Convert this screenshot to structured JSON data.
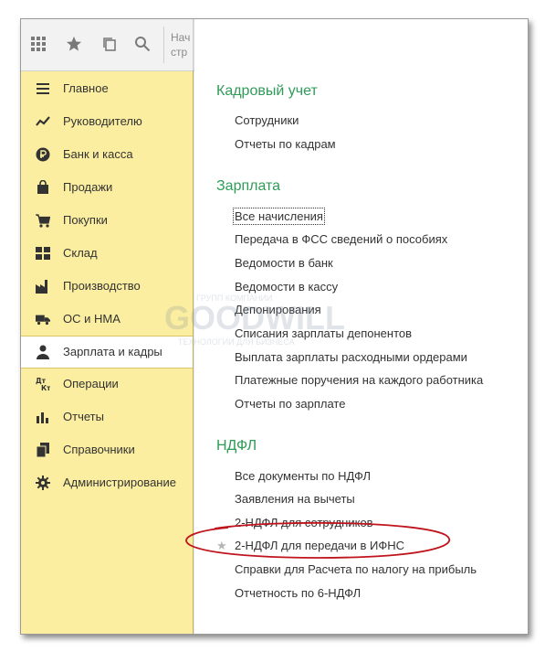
{
  "toolbar": {
    "hint_lines": [
      "Нач",
      "стр"
    ],
    "icons": [
      "apps-grid-icon",
      "star-icon",
      "history-icon",
      "search-icon"
    ]
  },
  "sidebar": {
    "items": [
      {
        "label": "Главное",
        "icon": "menu-lines-icon",
        "active": false
      },
      {
        "label": "Руководителю",
        "icon": "trend-chart-icon",
        "active": false
      },
      {
        "label": "Банк и касса",
        "icon": "ruble-coin-icon",
        "active": false
      },
      {
        "label": "Продажи",
        "icon": "shopping-bag-icon",
        "active": false
      },
      {
        "label": "Покупки",
        "icon": "shopping-cart-icon",
        "active": false
      },
      {
        "label": "Склад",
        "icon": "warehouse-grid-icon",
        "active": false
      },
      {
        "label": "Производство",
        "icon": "factory-icon",
        "active": false
      },
      {
        "label": "ОС и НМА",
        "icon": "truck-icon",
        "active": false
      },
      {
        "label": "Зарплата и кадры",
        "icon": "person-icon",
        "active": true
      },
      {
        "label": "Операции",
        "icon": "operations-dtkt-icon",
        "active": false
      },
      {
        "label": "Отчеты",
        "icon": "bar-chart-icon",
        "active": false
      },
      {
        "label": "Справочники",
        "icon": "books-icon",
        "active": false
      },
      {
        "label": "Администрирование",
        "icon": "gear-icon",
        "active": false
      }
    ]
  },
  "panel": {
    "sections": [
      {
        "title": "Кадровый учет",
        "links": [
          "Сотрудники",
          "Отчеты по кадрам"
        ]
      },
      {
        "title": "Зарплата",
        "links": [
          "Все начисления",
          "Передача в ФСС сведений о пособиях",
          "Ведомости в банк",
          "Ведомости в кассу",
          "Депонирования",
          "Списания зарплаты депонентов",
          "Выплата зарплаты расходными ордерами",
          "Платежные поручения на каждого работника",
          "Отчеты по зарплате"
        ]
      },
      {
        "title": "НДФЛ",
        "links": [
          "Все документы по НДФЛ",
          "Заявления на вычеты",
          "2-НДФЛ для сотрудников",
          "2-НДФЛ для передачи в ИФНС",
          "Справки для Расчета по налогу на прибыль",
          "Отчетность по 6-НДФЛ"
        ]
      }
    ],
    "starred_link": "2-НДФЛ для передачи в ИФНС",
    "star_glyph": "★"
  },
  "watermark": {
    "brand": "GOODWILL",
    "top_line": "ГРУПП КОМПАНИИ",
    "bottom_line": "ТЕХНОЛОГИИ ДЛЯ БИЗНЕСА"
  },
  "colors": {
    "sidebar_bg": "#fbeea0",
    "section_title": "#2f9b58",
    "annotation_ellipse": "#c0141c"
  }
}
